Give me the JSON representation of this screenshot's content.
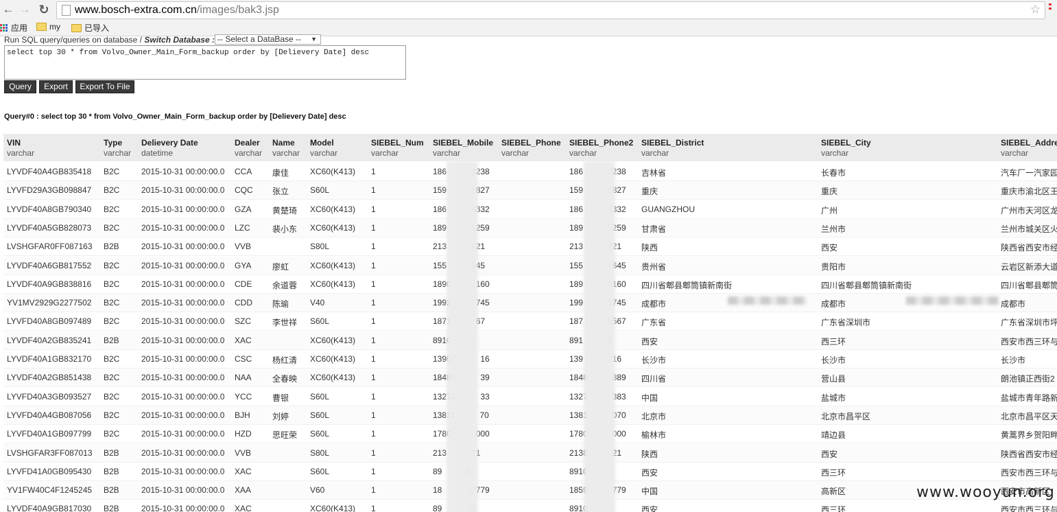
{
  "browser": {
    "url_host": "www.bosch-extra.com.cn",
    "url_path": "/images/bak3.jsp",
    "bookmarks": [
      "应用",
      "my",
      "已导入"
    ]
  },
  "form": {
    "run_label_prefix": "Run SQL query/queries on database / ",
    "run_label_switch": "Switch Database :",
    "select_value": "-- Select a DataBase --",
    "sql": "select  top 30 * from Volvo_Owner_Main_Form_backup order by [Delievery Date] desc",
    "buttons": {
      "query": "Query",
      "export": "Export",
      "export_file": "Export To File"
    },
    "query_title": "Query#0 : select top 30 * from Volvo_Owner_Main_Form_backup order by [Delievery Date] desc"
  },
  "table": {
    "columns": [
      {
        "name": "VIN",
        "type": "varchar"
      },
      {
        "name": "Type",
        "type": "varchar"
      },
      {
        "name": "Delievery Date",
        "type": "datetime"
      },
      {
        "name": "Dealer",
        "type": "varchar"
      },
      {
        "name": "Name",
        "type": "varchar"
      },
      {
        "name": "Model",
        "type": "varchar"
      },
      {
        "name": "SIEBEL_Num",
        "type": "varchar"
      },
      {
        "name": "SIEBEL_Mobile",
        "type": "varchar"
      },
      {
        "name": "SIEBEL_Phone",
        "type": "varchar"
      },
      {
        "name": "SIEBEL_Phone2",
        "type": "varchar"
      },
      {
        "name": "SIEBEL_District",
        "type": "varchar"
      },
      {
        "name": "SIEBEL_City",
        "type": "varchar"
      },
      {
        "name": "SIEBEL_Addre",
        "type": "varchar"
      }
    ],
    "rows": [
      [
        "LYVDF40A4GB835418",
        "B2C",
        "2015-10-31 00:00:00.0",
        "CCA",
        "康佳",
        "XC60(K413)",
        "1",
        "186   3238",
        "",
        "186   3238",
        "吉林省",
        "长春市",
        "汽车厂一汽家园"
      ],
      [
        "LYVFD29A3GB098847",
        "B2C",
        "2015-10-31 00:00:00.0",
        "CQC",
        "张立",
        "S60L",
        "1",
        "159   0827",
        "",
        "159   0827",
        "重庆",
        "重庆",
        "重庆市渝北区王"
      ],
      [
        "LYVDF40A8GB790340",
        "B2C",
        "2015-10-31 00:00:00.0",
        "GZA",
        "黄楚琦",
        "XC60(K413)",
        "1",
        "186   4332",
        "",
        "186   4332",
        "GUANGZHOU",
        "广州",
        "广州市天河区龙"
      ],
      [
        "LYVDF40A5GB828073",
        "B2C",
        "2015-10-31 00:00:00.0",
        "LZC",
        "裴小东",
        "XC60(K413)",
        "1",
        "189   5259",
        "",
        "189   5259",
        "甘肃省",
        "兰州市",
        "兰州市城关区火"
      ],
      [
        "LVSHGFAR0FF087163",
        "B2B",
        "2015-10-31 00:00:00.0",
        "VVB",
        "",
        "S80L",
        "1",
        "213   421",
        "",
        "213   421",
        "陕西",
        "西安",
        "陕西省西安市经"
      ],
      [
        "LYVDF40A6GB817552",
        "B2C",
        "2015-10-31 00:00:00.0",
        "GYA",
        "廖虹",
        "XC60(K413)",
        "1",
        "155   645",
        "",
        "155   7645",
        "贵州省",
        "贵阳市",
        "云岩区新添大道"
      ],
      [
        "LYVDF40A9GB838816",
        "B2C",
        "2015-10-31 00:00:00.0",
        "CDE",
        "余道蓉",
        "XC60(K413)",
        "1",
        "1890   160",
        "",
        "189   0160",
        "四川省郫县郫筒镇新南街",
        "四川省郫县郫筒镇新南街",
        "四川省郫县郫筒"
      ],
      [
        "YV1MV2929G2277502",
        "B2C",
        "2015-10-31 00:00:00.0",
        "CDD",
        "陈瑜",
        "V40",
        "1",
        "1992   745",
        "",
        "199   5745",
        "成都市",
        "成都市",
        "成都市"
      ],
      [
        "LYVFD40A8GB097489",
        "B2C",
        "2015-10-31 00:00:00.0",
        "SZC",
        "李世祥",
        "S60L",
        "1",
        "1871   67",
        "",
        "187   5567",
        "广东省",
        "广东省深圳市",
        "广东省深圳市坪"
      ],
      [
        "LYVDF40A2GB835241",
        "B2B",
        "2015-10-31 00:00:00.0",
        "XAC",
        "",
        "XC60(K413)",
        "1",
        "8910",
        "",
        "891   9",
        "西安",
        "西三环",
        "西安市西三环与"
      ],
      [
        "LYVDF40A1GB832170",
        "B2C",
        "2015-10-31 00:00:00.0",
        "CSC",
        "杨红清",
        "XC60(K413)",
        "1",
        "13907   16",
        "",
        "139   216",
        "长沙市",
        "长沙市",
        "长沙市"
      ],
      [
        "LYVDF40A2GB851438",
        "B2C",
        "2015-10-31 00:00:00.0",
        "NAA",
        "全春映",
        "XC60(K413)",
        "1",
        "18485   39",
        "",
        "1848   889",
        "四川省",
        "营山县",
        "朗池镇正西街2"
      ],
      [
        "LYVFD40A3GB093527",
        "B2C",
        "2015-10-31 00:00:00.0",
        "YCC",
        "曹银",
        "S60L",
        "1",
        "13270   33",
        "",
        "1327   383",
        "中国",
        "盐城市",
        "盐城市青年路新"
      ],
      [
        "LYVFD40A4GB087056",
        "B2C",
        "2015-10-31 00:00:00.0",
        "BJH",
        "刘婷",
        "S60L",
        "1",
        "13811   70",
        "",
        "1381   070",
        "北京市",
        "北京市昌平区",
        "北京市昌平区天"
      ],
      [
        "LYVFD40A1GB097799",
        "B2C",
        "2015-10-31 00:00:00.0",
        "HZD",
        "思旺荣",
        "S60L",
        "1",
        "1780   000",
        "",
        "1780   000",
        "榆林市",
        "靖边县",
        "黄蒿界乡贺阳畔"
      ],
      [
        "LVSHGFAR3FF087013",
        "B2B",
        "2015-10-31 00:00:00.0",
        "VVB",
        "",
        "S80L",
        "1",
        "213   21",
        "",
        "2138   21",
        "陕西",
        "西安",
        "陕西省西安市经"
      ],
      [
        "LYVFD41A0GB095430",
        "B2B",
        "2015-10-31 00:00:00.0",
        "XAC",
        "",
        "S60L",
        "1",
        "89   9",
        "",
        "8910",
        "西安",
        "西三环",
        "西安市西三环与"
      ],
      [
        "YV1FW40C4F1245245",
        "B2B",
        "2015-10-31 00:00:00.0",
        "XAA",
        "",
        "V60",
        "1",
        "18   32779",
        "",
        "1859   779",
        "中国",
        "高新区",
        "西安市高新区"
      ],
      [
        "LYVDF40A9GB817030",
        "B2B",
        "2015-10-31 00:00:00.0",
        "XAC",
        "",
        "XC60(K413)",
        "1",
        "89   79",
        "",
        "8910",
        "西安",
        "西三环",
        "西安市西三环与"
      ]
    ]
  },
  "watermark": "www.wooyun.org"
}
